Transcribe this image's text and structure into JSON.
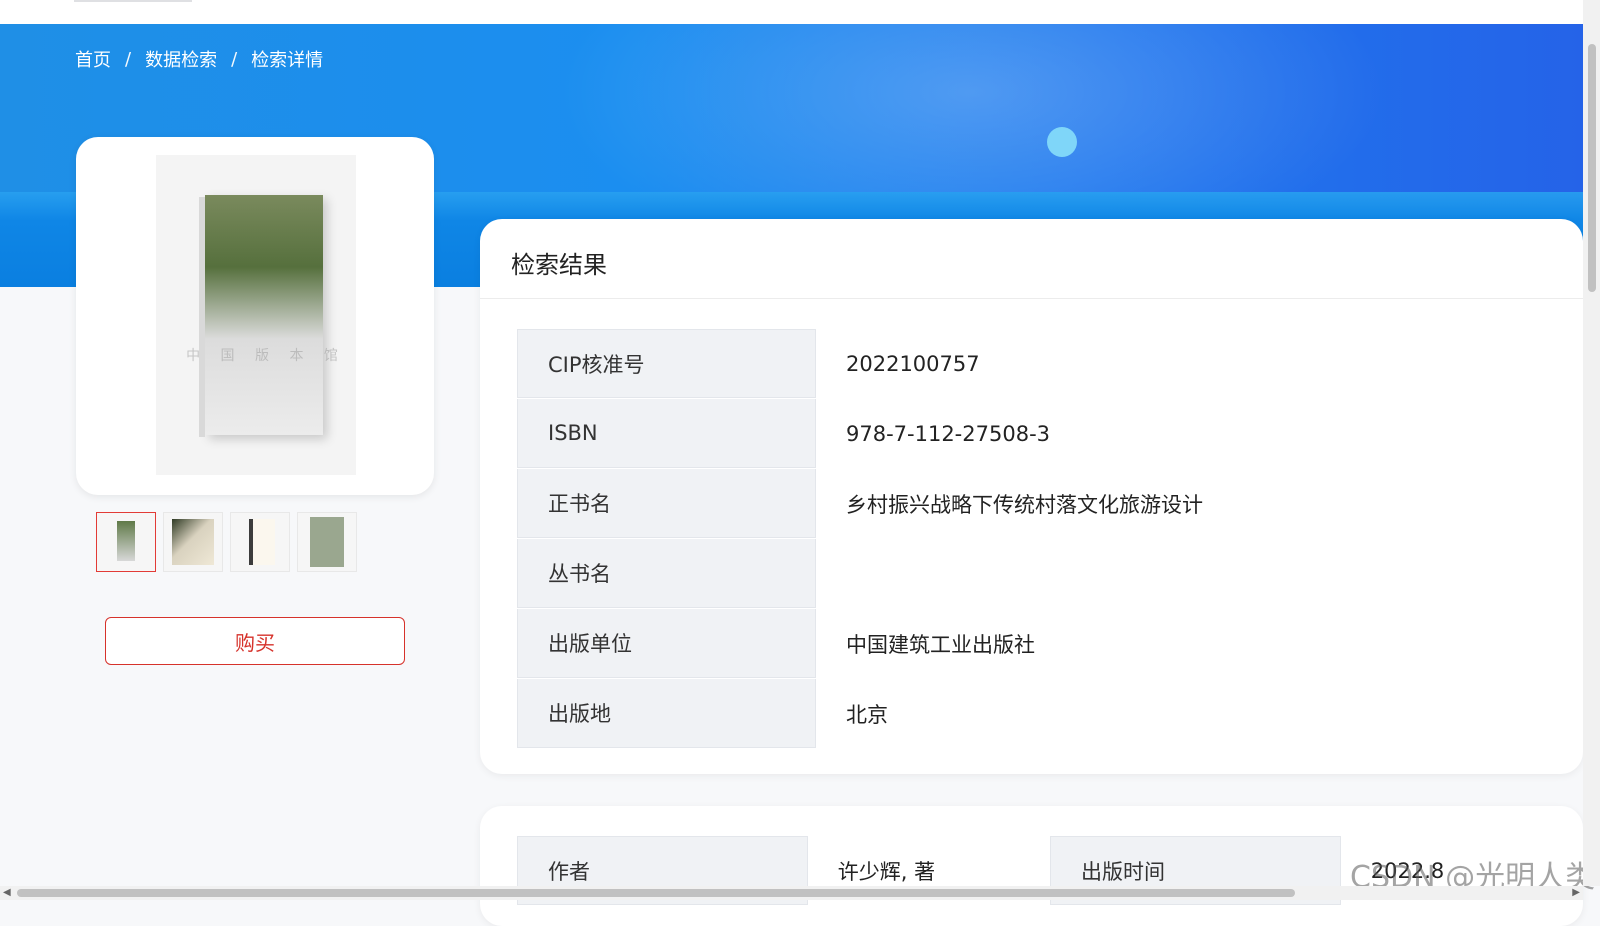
{
  "breadcrumb": {
    "items": [
      "首页",
      "数据检索",
      "检索详情"
    ],
    "separator": "/"
  },
  "cover": {
    "watermark": "中 国 版 本 馆",
    "thumbnails": [
      {
        "name": "thumb-1",
        "active": true
      },
      {
        "name": "thumb-2",
        "active": false
      },
      {
        "name": "thumb-3",
        "active": false
      },
      {
        "name": "thumb-4",
        "active": false
      }
    ]
  },
  "buy_button": "购买",
  "result_panel": {
    "title": "检索结果",
    "rows": [
      {
        "label": "CIP核准号",
        "value": "2022100757"
      },
      {
        "label": "ISBN",
        "value": "978-7-112-27508-3"
      },
      {
        "label": "正书名",
        "value": "乡村振兴战略下传统村落文化旅游设计"
      },
      {
        "label": "丛书名",
        "value": ""
      },
      {
        "label": "出版单位",
        "value": "中国建筑工业出版社"
      },
      {
        "label": "出版地",
        "value": "北京"
      }
    ]
  },
  "second_panel": {
    "author_label": "作者",
    "author_value": "许少辉, 著",
    "pubdate_label": "出版时间",
    "pubdate_value": "2022.8"
  },
  "watermark_overlay": "CSDN @光明人类",
  "colors": {
    "banner_blue": "#1f8fe6",
    "accent_red": "#d6322b",
    "label_bg": "#f0f2f5"
  }
}
